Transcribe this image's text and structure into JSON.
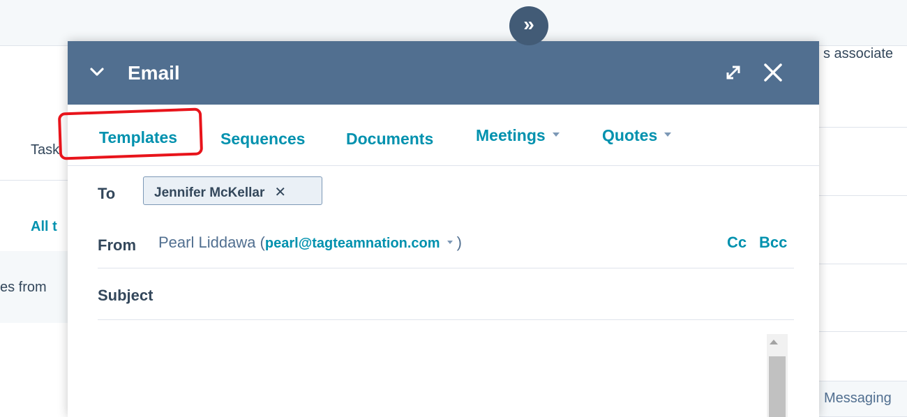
{
  "background": {
    "partial_top_right": "s associate",
    "task_label": "Task",
    "all_link": "All t",
    "from_text": "es from",
    "expand_icon_glyph": "»",
    "messaging_tab": "Messaging"
  },
  "dialog": {
    "title": "Email",
    "header_color": "#516f90",
    "icons": {
      "collapse": "chevron-down-icon",
      "expand": "expand-icon",
      "close": "close-icon"
    }
  },
  "toolbar": {
    "templates": "Templates",
    "sequences": "Sequences",
    "documents": "Documents",
    "meetings": "Meetings",
    "quotes": "Quotes",
    "accent_color": "#0091ae"
  },
  "to": {
    "label": "To",
    "recipient": "Jennifer McKellar",
    "remove_glyph": "✕"
  },
  "from": {
    "label": "From",
    "name": "Pearl Liddawa",
    "open_paren": " (",
    "email": "pearl@tagteamnation.com",
    "close_paren": ")",
    "cc": "Cc",
    "bcc": "Bcc"
  },
  "subject": {
    "label": "Subject",
    "value": ""
  },
  "annotation_color": "#e8141b"
}
